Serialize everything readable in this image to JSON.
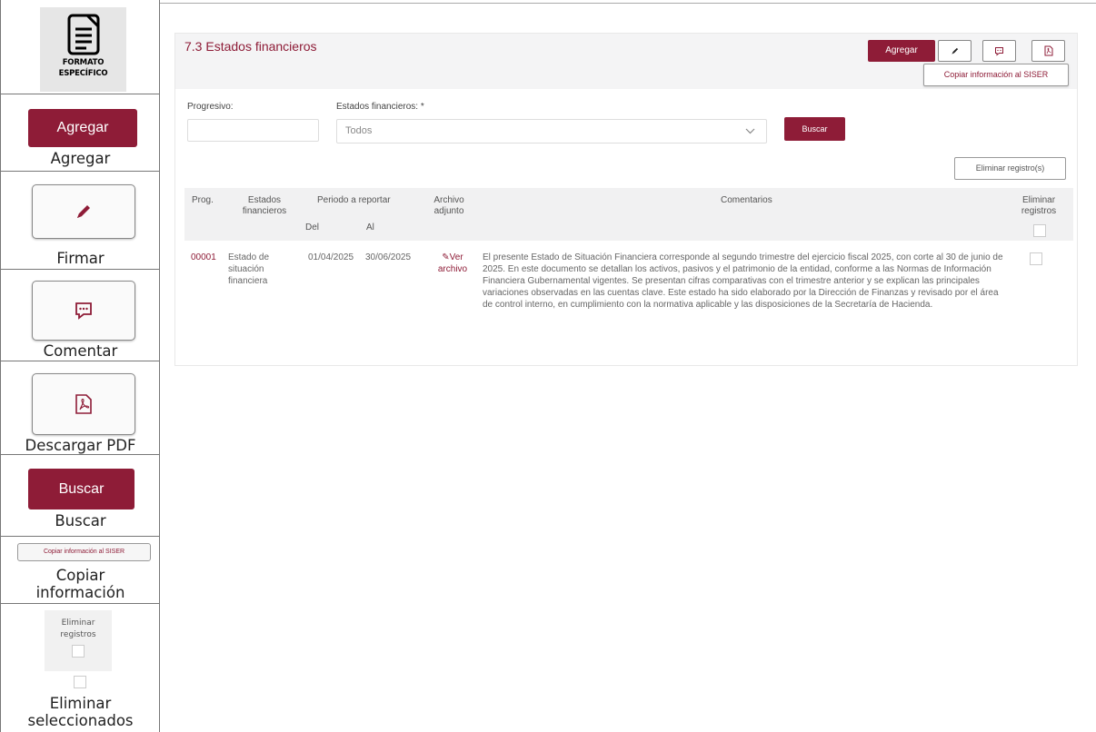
{
  "legend": {
    "logo_line1": "FORMATO",
    "logo_line2": "ESPECÍFICO",
    "agregar_btn": "Agregar",
    "agregar_caption": "Agregar",
    "firmar_caption": "Firmar",
    "comentar_caption": "Comentar",
    "pdf_caption": "Descargar PDF",
    "buscar_btn": "Buscar",
    "buscar_caption": "Buscar",
    "copiar_btn": "Copiar información al SISER",
    "copiar_caption_1": "Copiar",
    "copiar_caption_2": "información",
    "elim_header_1": "Eliminar",
    "elim_header_2": "registros",
    "elim_caption_1": "Eliminar",
    "elim_caption_2": "seleccionados"
  },
  "panel": {
    "title": "7.3 Estados financieros",
    "agregar": "Agregar",
    "copiar": "Copiar información al SISER",
    "eliminar": "Eliminar registro(s)",
    "buscar": "Buscar"
  },
  "filters": {
    "progresivo_label": "Progresivo:",
    "progresivo_value": "",
    "estados_label": "Estados financieros: *",
    "estados_value": "Todos"
  },
  "table": {
    "headers": {
      "prog": "Prog.",
      "estados_1": "Estados",
      "estados_2": "financieros",
      "periodo": "Periodo a reportar",
      "del": "Del",
      "al": "Al",
      "archivo_1": "Archivo",
      "archivo_2": "adjunto",
      "comentarios": "Comentarios",
      "eliminar_1": "Eliminar",
      "eliminar_2": "registros"
    },
    "rows": [
      {
        "prog": "00001",
        "estado_1": "Estado de",
        "estado_2": "situación",
        "estado_3": "financiera",
        "del": "01/04/2025",
        "al": "30/06/2025",
        "archivo_1": "✎Ver",
        "archivo_2": "archivo",
        "comentarios": "El presente Estado de Situación Financiera corresponde al segundo trimestre del ejercicio fiscal 2025, con corte al 30 de junio de 2025. En este documento se detallan los activos, pasivos y el patrimonio de la entidad, conforme a las Normas de Información Financiera Gubernamental vigentes. Se presentan cifras comparativas con el trimestre anterior y se explican las principales variaciones observadas en las cuentas clave. Este estado ha sido elaborado por la Dirección de Finanzas y revisado por el área de control interno, en cumplimiento con la normativa aplicable y las disposiciones de la Secretaría de Hacienda."
      }
    ]
  },
  "colors": {
    "accent": "#8e1c37"
  },
  "icons": [
    "document-icon",
    "pen-icon",
    "comment-icon",
    "pdf-icon",
    "chevron-down-icon",
    "checkbox-icon"
  ]
}
